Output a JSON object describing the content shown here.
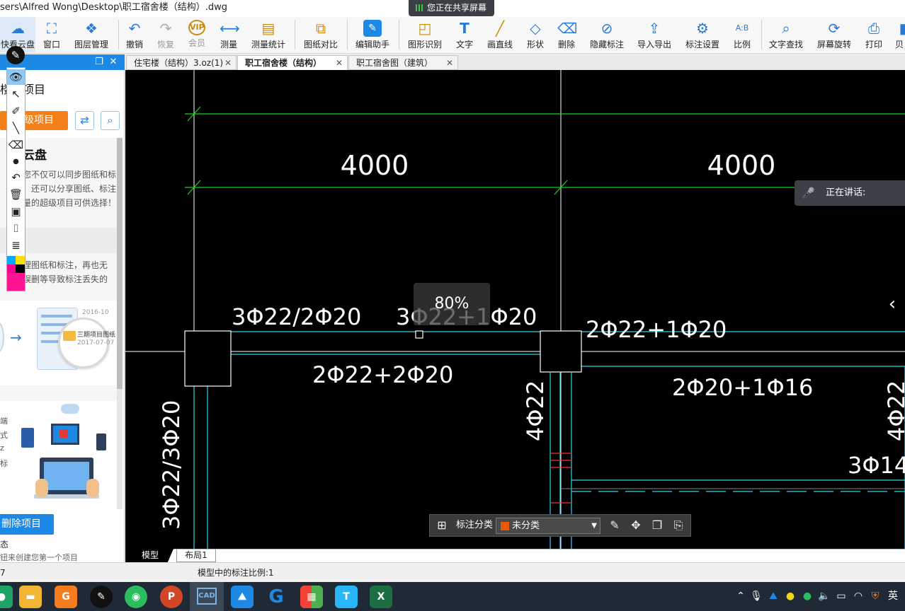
{
  "window": {
    "title": "sers\\Alfred Wong\\Desktop\\职工宿舍楼（结构）.dwg"
  },
  "share": {
    "label": "您正在共享屏幕"
  },
  "toolbar": {
    "items": [
      {
        "label": "快看云盘",
        "icon": "cloud-icon"
      },
      {
        "label": "窗口",
        "icon": "window-icon"
      },
      {
        "label": "图层管理",
        "icon": "layers-icon"
      },
      {
        "label": "撤销",
        "icon": "undo-icon"
      },
      {
        "label": "恢复",
        "icon": "redo-icon"
      },
      {
        "label": "会员",
        "icon": "vip-icon"
      },
      {
        "label": "测量",
        "icon": "ruler-icon"
      },
      {
        "label": "测量统计",
        "icon": "measure-stats-icon"
      },
      {
        "label": "图纸对比",
        "icon": "compare-icon"
      },
      {
        "label": "编辑助手",
        "icon": "edit-assistant-icon"
      },
      {
        "label": "图形识别",
        "icon": "shape-recognize-icon"
      },
      {
        "label": "文字",
        "icon": "text-icon"
      },
      {
        "label": "画直线",
        "icon": "line-icon"
      },
      {
        "label": "形状",
        "icon": "shape-icon"
      },
      {
        "label": "删除",
        "icon": "eraser-icon"
      },
      {
        "label": "隐藏标注",
        "icon": "hide-annotation-icon"
      },
      {
        "label": "导入导出",
        "icon": "import-export-icon"
      },
      {
        "label": "标注设置",
        "icon": "annotation-settings-icon"
      },
      {
        "label": "比例",
        "icon": "scale-icon"
      },
      {
        "label": "文字查找",
        "icon": "text-search-icon"
      },
      {
        "label": "屏幕旋转",
        "icon": "rotate-screen-icon"
      },
      {
        "label": "打印",
        "icon": "printer-icon"
      },
      {
        "label": "贝",
        "icon": "more-icon"
      }
    ]
  },
  "left_panel": {
    "title": "楼构项目",
    "super_project_button": "超级项目",
    "card_title": "云盘",
    "card_text_1": "您不仅可以同步图纸和标",
    "card_text_2": "，还可以分享图纸、标注",
    "card_text_3": "量的超级项目可供选择！",
    "card_text_4": "理图纸和标注，再也无",
    "card_text_5": "误删等导致标注丢失的",
    "illus_date_1": "2016-10",
    "illus_folder": "三期项目图纸",
    "illus_date_2": "2017-07-07",
    "side_char_1": "端",
    "side_char_2": "式",
    "side_char_3": "z",
    "side_char_4": "标",
    "delete_button": "删除项目",
    "bottom_text_1": "态",
    "bottom_text_2": "钮来创建您第一个项目"
  },
  "tabs": [
    {
      "label": "住宅楼（结构）3.oz(1)",
      "close": "✕"
    },
    {
      "label": "职工宿舍楼（结构）",
      "close": "✕"
    },
    {
      "label": "职工宿舍图（建筑）",
      "close": "✕"
    }
  ],
  "drawing": {
    "dim_left": "4000",
    "dim_right": "4000",
    "rebar_top_left": "3Φ22/2Φ20",
    "rebar_top_mid": "3Φ22+1Φ20",
    "rebar_bottom_left": "2Φ22+2Φ20",
    "rebar_top_right": "2Φ22+1Φ20",
    "rebar_right": "2Φ20+1Φ16",
    "rebar_vertical_left": "3Φ22/3Φ20",
    "rebar_vertical_mid": "4Φ22",
    "rebar_vertical_right": "4Φ22",
    "rebar_right_small": "3Φ14"
  },
  "overlay": {
    "zoom": "80%",
    "speaking": "正在讲话:"
  },
  "annotation_category": {
    "label": "标注分类",
    "selected": "未分类",
    "selected_color": "#e8590c"
  },
  "layout_tabs": [
    "模型",
    "布局1"
  ],
  "status": {
    "left": "7",
    "scale_text": "模型中的标注比例:1"
  },
  "taskbar": {
    "ime": "英"
  },
  "colors": {
    "accent": "#1e88e5",
    "orange": "#f4801a",
    "cad_green": "#1bd21b",
    "cad_cyan": "#2fd4e6"
  }
}
